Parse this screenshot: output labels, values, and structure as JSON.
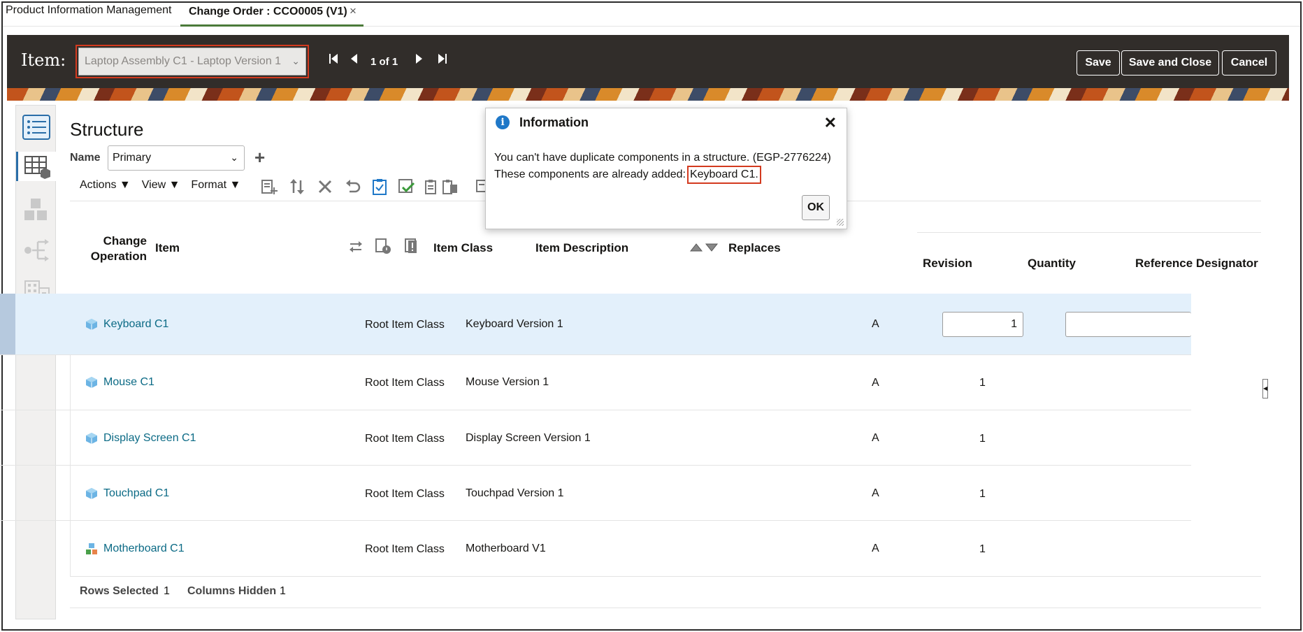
{
  "tabs": {
    "app": "Product Information Management",
    "active": "Change Order : CCO0005 (V1)",
    "close": "×"
  },
  "header": {
    "item_label": "Item:",
    "item_value": "Laptop Assembly C1 - Laptop Version 1",
    "pager": "1 of 1",
    "save": "Save",
    "save_close": "Save and Close",
    "cancel": "Cancel"
  },
  "structure": {
    "title": "Structure",
    "name_label": "Name",
    "name_value": "Primary",
    "menus": [
      "Actions ▼",
      "View ▼",
      "Format ▼"
    ]
  },
  "table": {
    "columns": {
      "change_operation": "Change Operation",
      "item": "Item",
      "item_class": "Item Class",
      "item_description": "Item Description",
      "replaces": "Replaces",
      "revision": "Revision",
      "quantity": "Quantity",
      "reference_designator": "Reference Designator"
    },
    "rows": [
      {
        "item": "Keyboard C1",
        "item_class": "Root Item Class",
        "description": "Keyboard Version 1",
        "revision": "A",
        "quantity": "1"
      },
      {
        "item": "Mouse C1",
        "item_class": "Root Item Class",
        "description": "Mouse Version 1",
        "revision": "A",
        "quantity": "1"
      },
      {
        "item": "Display Screen C1",
        "item_class": "Root Item Class",
        "description": "Display Screen Version 1",
        "revision": "A",
        "quantity": "1"
      },
      {
        "item": "Touchpad C1",
        "item_class": "Root Item Class",
        "description": "Touchpad Version 1",
        "revision": "A",
        "quantity": "1"
      },
      {
        "item": "Motherboard C1",
        "item_class": "Root Item Class",
        "description": "Motherboard V1",
        "revision": "A",
        "quantity": "1"
      }
    ]
  },
  "footer": {
    "rows_selected_label": "Rows Selected",
    "rows_selected_value": "1",
    "columns_hidden_label": "Columns Hidden",
    "columns_hidden_value": "1"
  },
  "dialog": {
    "title": "Information",
    "line1": "You can't have duplicate components in a structure. (EGP-2776224)",
    "line2": "These components are already added:",
    "highlight": "Keyboard C1.",
    "ok": "OK"
  },
  "colors": {
    "header_bg": "#312d2a",
    "link": "#0b6a85",
    "highlight_border": "#d33a1f",
    "selected_row": "#e3f0fb",
    "tab_underline": "#4b7a3a"
  }
}
